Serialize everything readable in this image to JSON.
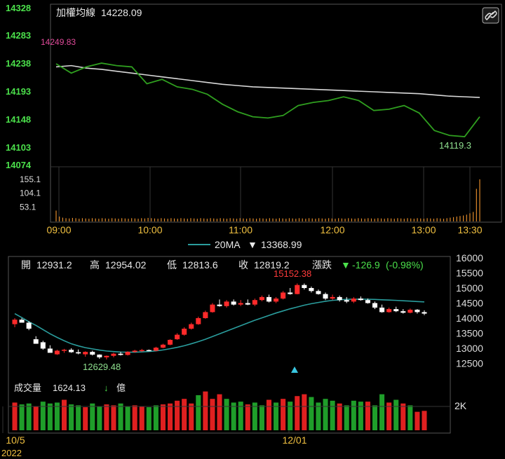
{
  "intraday": {
    "title": "加權均線",
    "value": "14228.09",
    "y_ticks": [
      "14328",
      "14283",
      "14238",
      "14193",
      "14148",
      "14103",
      "14074"
    ],
    "y_tick_values": [
      14328,
      14283,
      14238,
      14193,
      14148,
      14103,
      14074
    ],
    "high_label": "14249.83",
    "low_label": "14119.3",
    "vol_ticks": [
      "155.1",
      "104.1",
      "53.1"
    ],
    "vol_tick_values": [
      155.1,
      104.1,
      53.1
    ],
    "x_ticks": [
      "09:00",
      "10:00",
      "11:00",
      "12:00",
      "13:00",
      "13:30"
    ],
    "link_icon": "link-icon",
    "avg_color": "#d8d8d8",
    "price_color": "#2f9e1f",
    "vol_color": "#e08a2a"
  },
  "daily": {
    "ma_legend": "20MA",
    "ma_value": "13368.99",
    "ma_arrow": "▼",
    "open_label": "開",
    "open": "12931.2",
    "high_label": "高",
    "high": "12954.02",
    "low_label": "低",
    "low": "12813.6",
    "close_label": "收",
    "close": "12819.2",
    "change_label": "漲跌",
    "change_arrow": "▼",
    "change": "-126.9",
    "change_pct": "(-0.98%)",
    "max_annotation": "15152.38",
    "min_annotation": "12629.48",
    "y_ticks": [
      "16000",
      "15500",
      "15000",
      "14500",
      "14000",
      "13500",
      "13000",
      "12500"
    ],
    "y_tick_values": [
      16000,
      15500,
      15000,
      14500,
      14000,
      13500,
      13000,
      12500
    ],
    "volume_title": "成交量",
    "volume_value": "1624.13",
    "volume_arrow": "↓",
    "volume_unit": "億",
    "volume_tick": "2K",
    "x_ticks": [
      "10/5",
      "12/01"
    ],
    "year_label": "2022",
    "ma_color": "#2a9d9d",
    "up_color": "#ff2a2a",
    "down_color": "#ffffff",
    "vol_up_color": "#e02020",
    "vol_down_color": "#1f9e2a"
  },
  "chart_data": [
    {
      "type": "line",
      "x": [
        "09:00",
        "09:10",
        "09:20",
        "09:30",
        "09:40",
        "09:50",
        "10:00",
        "10:10",
        "10:20",
        "10:30",
        "10:40",
        "10:50",
        "11:00",
        "11:10",
        "11:20",
        "11:30",
        "11:40",
        "11:50",
        "12:00",
        "12:10",
        "12:20",
        "12:30",
        "12:40",
        "12:50",
        "13:00",
        "13:10",
        "13:20",
        "13:25",
        "13:30"
      ],
      "series": [
        {
          "values": [
            14237,
            14222,
            14232,
            14238,
            14234,
            14232,
            14205,
            14212,
            14200,
            14196,
            14188,
            14172,
            14160,
            14152,
            14150,
            14154,
            14170,
            14175,
            14178,
            14184,
            14178,
            14162,
            14164,
            14170,
            14158,
            14130,
            14122,
            14120,
            14152
          ]
        },
        {
          "values": [
            14232,
            14234,
            14230,
            14228,
            14225,
            14222,
            14219,
            14216,
            14213,
            14210,
            14207,
            14204,
            14202,
            14200,
            14199,
            14198,
            14197,
            14196,
            14195,
            14194,
            14193,
            14192,
            14191,
            14190,
            14189,
            14187,
            14185,
            14184,
            14183
          ]
        }
      ],
      "y_ticks": [
        14328,
        14283,
        14238,
        14193,
        14148,
        14103,
        14074
      ],
      "ylim": [
        14074,
        14328
      ],
      "annotations": [
        "14249.83",
        "14119.3"
      ],
      "volume": {
        "ticks": [
          155.1,
          104.1,
          53.1
        ],
        "values": [
          40,
          18,
          14,
          12,
          11,
          13,
          12,
          10,
          12,
          11,
          10,
          12,
          11,
          10,
          12,
          11,
          10,
          12,
          11,
          10,
          12,
          11,
          10,
          12,
          11,
          10,
          12,
          11,
          13,
          12,
          11,
          10,
          12,
          11,
          10,
          12,
          11,
          10,
          12,
          11,
          10,
          12,
          11,
          10,
          12,
          11,
          10,
          12,
          11,
          10,
          12,
          11,
          10,
          12,
          11,
          10,
          12,
          11,
          10,
          12,
          11,
          10,
          12,
          11,
          10,
          12,
          11,
          10,
          12,
          11,
          10,
          12,
          11,
          10,
          12,
          11,
          10,
          12,
          11,
          10,
          12,
          11,
          10,
          12,
          11,
          10,
          12,
          11,
          10,
          12,
          11,
          10,
          12,
          11,
          10,
          12,
          11,
          10,
          12,
          11,
          10,
          12,
          11,
          10,
          12,
          11,
          10,
          12,
          11,
          10,
          12,
          11,
          10,
          12,
          11,
          10,
          12,
          11,
          10,
          12,
          14,
          16,
          18,
          20,
          22,
          25,
          30,
          35,
          120,
          155
        ]
      }
    },
    {
      "type": "candlestick",
      "x_ticks": [
        "10/5",
        "12/01"
      ],
      "y_ticks": [
        16000,
        15500,
        15000,
        14500,
        14000,
        13500,
        13000,
        12500
      ],
      "ylim": [
        12000,
        16000
      ],
      "candles": [
        [
          13800,
          14000,
          13700,
          13950
        ],
        [
          13950,
          14000,
          13900,
          13850
        ],
        [
          13850,
          13900,
          13600,
          13650
        ],
        [
          13300,
          13400,
          13150,
          13150
        ],
        [
          13200,
          13250,
          12950,
          12990
        ],
        [
          12990,
          13100,
          12850,
          12850
        ],
        [
          12800,
          12950,
          12780,
          12920
        ],
        [
          12920,
          12980,
          12850,
          12950
        ],
        [
          12950,
          13000,
          12850,
          12870
        ],
        [
          12870,
          12960,
          12800,
          12830
        ],
        [
          12800,
          12900,
          12720,
          12880
        ],
        [
          12880,
          12920,
          12760,
          12790
        ],
        [
          12790,
          12800,
          12650,
          12700
        ],
        [
          12700,
          12760,
          12630,
          12750
        ],
        [
          12750,
          12850,
          12700,
          12820
        ],
        [
          12820,
          12880,
          12760,
          12780
        ],
        [
          12780,
          12900,
          12760,
          12880
        ],
        [
          12880,
          12950,
          12850,
          12920
        ],
        [
          12920,
          12980,
          12880,
          12940
        ],
        [
          12940,
          12960,
          12900,
          12920
        ],
        [
          12920,
          13050,
          12900,
          13020
        ],
        [
          13020,
          13150,
          13000,
          13120
        ],
        [
          13120,
          13300,
          13100,
          13280
        ],
        [
          13300,
          13500,
          13280,
          13450
        ],
        [
          13450,
          13700,
          13420,
          13650
        ],
        [
          13650,
          13850,
          13620,
          13800
        ],
        [
          13800,
          14050,
          13780,
          14000
        ],
        [
          14000,
          14250,
          13980,
          14200
        ],
        [
          14200,
          14500,
          14180,
          14450
        ],
        [
          14450,
          14620,
          14380,
          14400
        ],
        [
          14400,
          14600,
          14350,
          14550
        ],
        [
          14550,
          14620,
          14420,
          14450
        ],
        [
          14450,
          14600,
          14400,
          14500
        ],
        [
          14500,
          14620,
          14430,
          14450
        ],
        [
          14450,
          14650,
          14400,
          14600
        ],
        [
          14600,
          14750,
          14560,
          14700
        ],
        [
          14700,
          14780,
          14520,
          14550
        ],
        [
          14550,
          14700,
          14500,
          14650
        ],
        [
          14650,
          14900,
          14620,
          14850
        ],
        [
          14850,
          15000,
          14780,
          14800
        ],
        [
          14800,
          15152,
          14790,
          15100
        ],
        [
          15100,
          15150,
          14950,
          15000
        ],
        [
          15000,
          15050,
          14850,
          14900
        ],
        [
          14900,
          14950,
          14780,
          14800
        ],
        [
          14800,
          14850,
          14600,
          14650
        ],
        [
          14650,
          14780,
          14600,
          14700
        ],
        [
          14700,
          14750,
          14550,
          14600
        ],
        [
          14600,
          14700,
          14500,
          14550
        ],
        [
          14550,
          14700,
          14500,
          14650
        ],
        [
          14650,
          14720,
          14580,
          14600
        ],
        [
          14600,
          14650,
          14480,
          14500
        ],
        [
          14500,
          14550,
          14300,
          14350
        ],
        [
          14350,
          14450,
          14180,
          14200
        ],
        [
          14200,
          14350,
          14180,
          14300
        ],
        [
          14300,
          14380,
          14200,
          14230
        ],
        [
          14230,
          14300,
          14150,
          14180
        ],
        [
          14180,
          14320,
          14160,
          14280
        ],
        [
          14280,
          14300,
          14150,
          14200
        ],
        [
          14200,
          14260,
          14100,
          14150
        ]
      ],
      "ma20": [
        14150,
        14020,
        13880,
        13760,
        13620,
        13480,
        13360,
        13250,
        13150,
        13080,
        13020,
        12980,
        12940,
        12910,
        12890,
        12875,
        12870,
        12870,
        12880,
        12895,
        12915,
        12945,
        12985,
        13030,
        13085,
        13150,
        13220,
        13300,
        13390,
        13480,
        13570,
        13660,
        13750,
        13840,
        13930,
        14010,
        14090,
        14170,
        14240,
        14310,
        14370,
        14430,
        14480,
        14520,
        14560,
        14590,
        14610,
        14625,
        14630,
        14630,
        14628,
        14620,
        14610,
        14600,
        14590,
        14578,
        14565,
        14552,
        14540
      ],
      "volume": {
        "tick": "2K",
        "up": [
          1,
          0,
          0,
          1,
          0,
          0,
          0,
          1,
          0,
          0,
          1,
          0,
          0,
          1,
          1,
          0,
          0,
          1,
          1,
          0,
          0,
          1,
          1,
          1,
          1,
          1,
          0,
          1,
          1,
          1,
          0,
          0,
          0,
          1,
          0,
          0,
          1,
          0,
          1,
          0,
          1,
          1,
          0,
          0,
          0,
          0,
          1,
          0,
          0,
          0,
          1,
          0,
          0,
          1,
          0,
          1,
          0,
          1,
          1
        ],
        "values": [
          1500,
          1400,
          1450,
          1300,
          1550,
          1450,
          1500,
          1650,
          1400,
          1350,
          1250,
          1450,
          1300,
          1400,
          1350,
          1450,
          1300,
          1350,
          1300,
          1250,
          1350,
          1400,
          1450,
          1600,
          1700,
          1450,
          1900,
          2100,
          1700,
          1950,
          1700,
          1500,
          1550,
          1400,
          1500,
          1350,
          1650,
          1500,
          1700,
          1550,
          1850,
          1950,
          1800,
          1500,
          1700,
          1600,
          1450,
          1350,
          1600,
          1550,
          1550,
          1350,
          1950,
          1500,
          1650,
          1450,
          1350,
          1000,
          1050,
          1050
        ]
      }
    }
  ]
}
